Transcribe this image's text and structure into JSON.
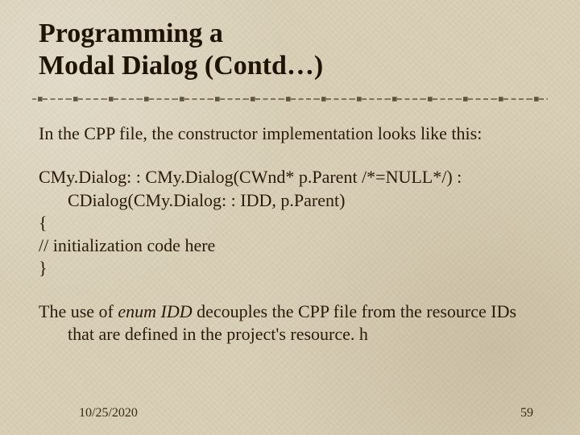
{
  "title_line1": "Programming a",
  "title_line2": "Modal Dialog (Contd…)",
  "intro": "In the CPP file, the constructor implementation looks like this:",
  "code": {
    "l1": "CMy.Dialog: : CMy.Dialog(CWnd* p.Parent /*=NULL*/) : CDialog(CMy.Dialog: : IDD, p.Parent)",
    "l2": "{",
    "l3": "// initialization code here",
    "l4": "}"
  },
  "closing_pre": "The use of ",
  "closing_em": "enum IDD",
  "closing_post": " decouples the CPP file from the resource IDs that are defined in the project's resource. h",
  "footer": {
    "date": "10/25/2020",
    "page": "59"
  }
}
